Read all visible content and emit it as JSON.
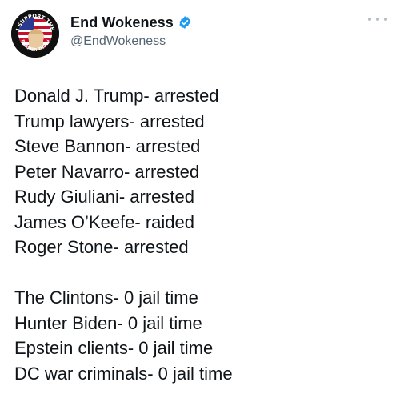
{
  "tweet": {
    "author": {
      "display_name": "End Wokeness",
      "handle": "@EndWokeness",
      "verified": true,
      "avatar_text_top": "I SUPPORT THE",
      "avatar_text_bottom": "FORMER THING"
    },
    "more_icon": "more-horizontal-icon",
    "paragraph_1": [
      "Donald J. Trump- arrested",
      "Trump lawyers- arrested",
      "Steve Bannon- arrested",
      "Peter Navarro- arrested",
      "Rudy Giuliani- arrested",
      "James O’Keefe- raided",
      "Roger Stone- arrested"
    ],
    "paragraph_2": [
      "The Clintons- 0 jail time",
      "Hunter Biden- 0 jail time",
      "Epstein clients- 0 jail time",
      "DC war criminals- 0 jail time"
    ]
  },
  "colors": {
    "text": "#0f1419",
    "secondary": "#536471",
    "verified_blue": "#1d9bf0"
  }
}
